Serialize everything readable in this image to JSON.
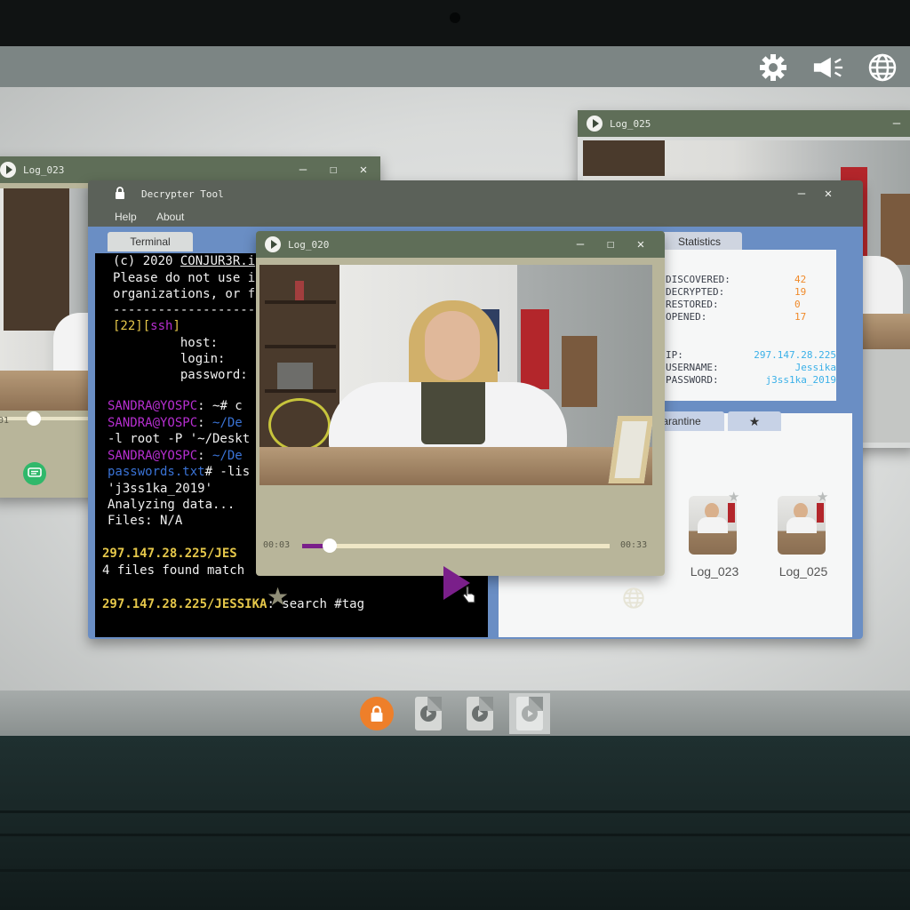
{
  "colors": {
    "window_titlebar": "#5f6e58",
    "decrypter_accent": "#6a8ec4",
    "terminal_user": "#b62ed0",
    "terminal_path": "#3a73d6",
    "terminal_host": "#e6c84a",
    "stat_value": "#f08a2a",
    "info_value": "#3ab0e8",
    "play_button": "#7a1f8a",
    "taskbar_lock": "#ee7f2a"
  },
  "topbar": {
    "icons": [
      "gear-icon",
      "megaphone-icon",
      "globe-icon"
    ]
  },
  "window_log025": {
    "title": "Log_025",
    "minimize": "—"
  },
  "window_log023": {
    "title": "Log_023",
    "minimize": "—",
    "maximize": "☐",
    "close": "✕",
    "time_partial": "01"
  },
  "decrypter": {
    "title": "Decrypter Tool",
    "minimize": "—",
    "close": "✕",
    "menu": {
      "help": "Help",
      "about": "About"
    },
    "tabs": {
      "terminal": "Terminal",
      "statistics": "Statistics",
      "quarantine": "arantine"
    },
    "terminal_lines": {
      "l1a": "(c) 2020 ",
      "l1b": "CONJUR3R.i",
      "l2": "Please do not use i",
      "l3": "organizations, or f",
      "l4": "-------------------",
      "l5a": "[22][",
      "l5b": "ssh",
      "l5c": "]",
      "l6": "         host:",
      "l7": "         login:",
      "l8": "         password:",
      "l9a": "SANDRA@YOSPC",
      "l9b": ": ~# c",
      "l10a": "SANDRA@YOSPC",
      "l10b": ": ",
      "l10c": "~/De",
      "l11": "-l root -P '~/Deskt",
      "l12a": "SANDRA@YOSPC",
      "l12b": ": ",
      "l12c": "~/De",
      "l13a": "passwords.txt",
      "l13b": "# -lis",
      "l14": "'j3ss1ka_2019'",
      "l15": "Analyzing data...",
      "l16": "Files: N/A",
      "l17a": "297.147.28.225/JES",
      "l18": "4 files found match",
      "l19a": "297.147.28.225/JESSIKA",
      "l19b": ": search #tag"
    },
    "stats": {
      "discovered_label": "DISCOVERED:",
      "discovered": "42",
      "decrypted_label": "DECRYPTED:",
      "decrypted": "19",
      "restored_label": "RESTORED:",
      "restored": "0",
      "opened_label": "OPENED:",
      "opened": "17",
      "ip_label": "IP:",
      "ip": "297.147.28.225",
      "username_label": "USERNAME:",
      "username": "Jessika",
      "password_label": "PASSWORD:",
      "password": "j3ss1ka_2019"
    },
    "favorites": [
      {
        "label": "Log_023"
      },
      {
        "label": "Log_025"
      }
    ]
  },
  "player": {
    "title": "Log_020",
    "minimize": "—",
    "maximize": "☐",
    "close": "✕",
    "time_current": "00:03",
    "time_total": "00:33",
    "progress": 0.09
  },
  "taskbar": {
    "items": [
      "lock-app",
      "video-file",
      "video-file",
      "video-file-active"
    ]
  }
}
